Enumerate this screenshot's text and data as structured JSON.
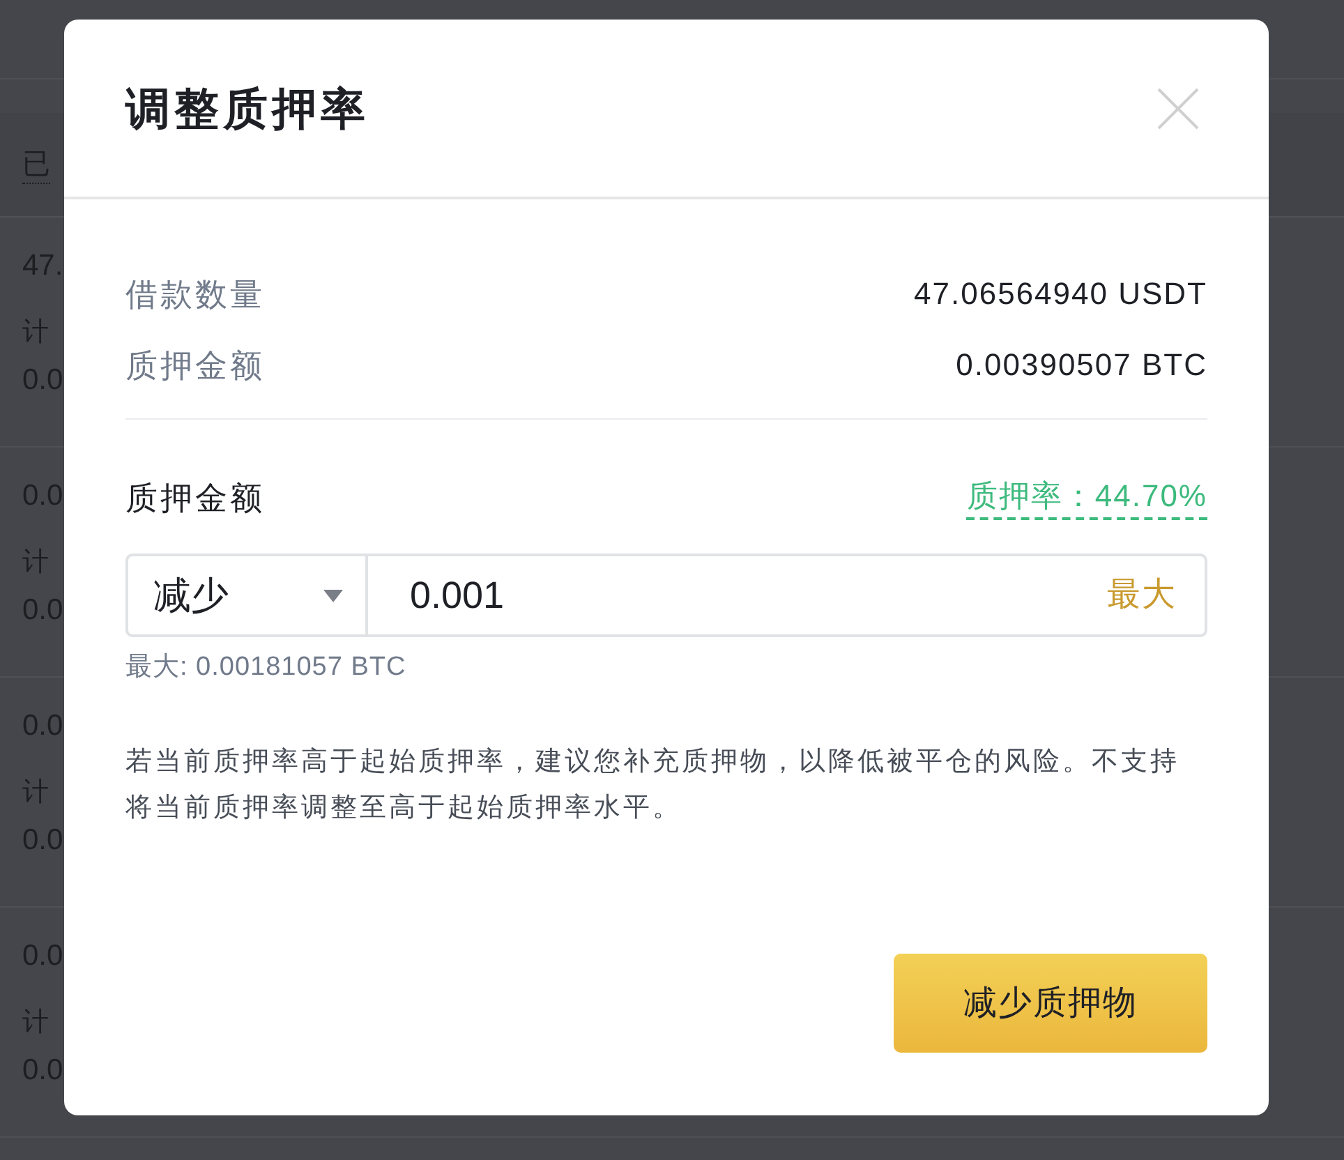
{
  "background": {
    "filter_label": "已",
    "rows": [
      {
        "amount": "47.",
        "label": "计",
        "value": "0.0"
      },
      {
        "amount": "0.0",
        "label": "计",
        "value": "0.0"
      },
      {
        "amount": "0.0",
        "label": "计",
        "value": "0.0"
      },
      {
        "amount": "0.0",
        "label": "计",
        "value": "0.0"
      }
    ]
  },
  "dialog": {
    "title": "调整质押率",
    "summary": [
      {
        "label": "借款数量",
        "value": "47.06564940 USDT"
      },
      {
        "label": "质押金额",
        "value": "0.00390507 BTC"
      }
    ],
    "adjust": {
      "label": "质押金额",
      "ratio": "质押率：44.70%",
      "mode": "减少",
      "amount": "0.001",
      "max_button": "最大",
      "max_hint": "最大: 0.00181057 BTC"
    },
    "notice": "若当前质押率高于起始质押率，建议您补充质押物，以降低被平仓的风险。不支持将当前质押率调整至高于起始质押率水平。",
    "submit": "减少质押物"
  }
}
